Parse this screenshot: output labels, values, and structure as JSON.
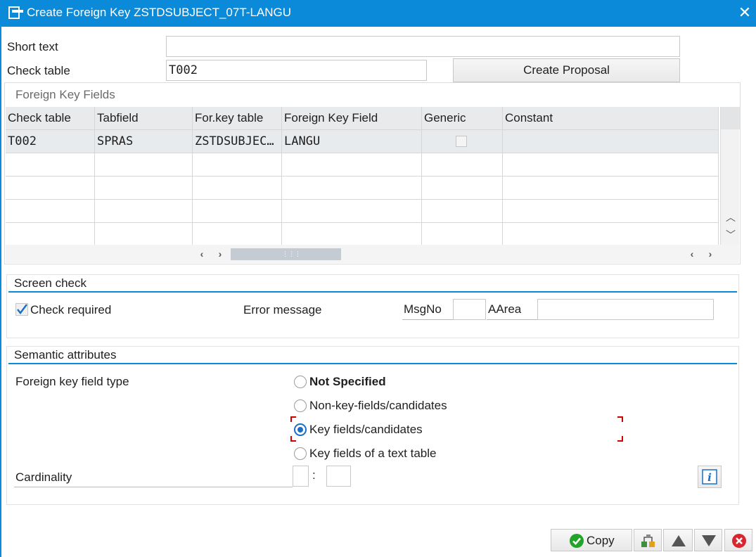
{
  "window": {
    "title": "Create Foreign Key ZSTDSUBJECT_07T-LANGU",
    "close_icon": "close-icon"
  },
  "form": {
    "short_text_label": "Short text",
    "short_text_value": "",
    "check_table_label": "Check table",
    "check_table_value": "T002",
    "create_proposal_label": "Create Proposal"
  },
  "fk_fields": {
    "title": "Foreign Key Fields",
    "columns": [
      "Check table",
      "Tabfield",
      "For.key table",
      "Foreign Key Field",
      "Generic",
      "Constant"
    ],
    "rows": [
      {
        "check_table": "T002",
        "tabfield": "SPRAS",
        "forkey_table": "ZSTDSUBJEC…",
        "forkey_field": "LANGU",
        "generic": false,
        "constant": ""
      }
    ],
    "empty_rows": 4
  },
  "screen_check": {
    "title": "Screen check",
    "check_required_label": "Check required",
    "check_required_checked": true,
    "error_message_label": "Error message",
    "msgno_label": "MsgNo",
    "msgno_value": "",
    "aarea_label": "AArea",
    "aarea_value": ""
  },
  "semantic": {
    "title": "Semantic attributes",
    "fk_field_type_label": "Foreign key field type",
    "options": [
      {
        "label": "Not Specified",
        "selected": false
      },
      {
        "label": "Non-key-fields/candidates",
        "selected": false
      },
      {
        "label": "Key fields/candidates",
        "selected": true
      },
      {
        "label": "Key fields of a text table",
        "selected": false
      }
    ],
    "cardinality_label": "Cardinality",
    "cardinality_left": "",
    "cardinality_sep": ":",
    "cardinality_right": "",
    "info_icon": "info-icon"
  },
  "footer": {
    "copy_label": "Copy",
    "buttons": [
      "copy-button",
      "hierarchy-button",
      "up-button",
      "down-button",
      "cancel-button"
    ]
  },
  "colors": {
    "titlebar": "#0a8ad8",
    "accent_line": "#0a8ad8",
    "focus_bracket": "#d40000",
    "ok_green": "#22a32a",
    "cancel_red": "#d9262e"
  }
}
